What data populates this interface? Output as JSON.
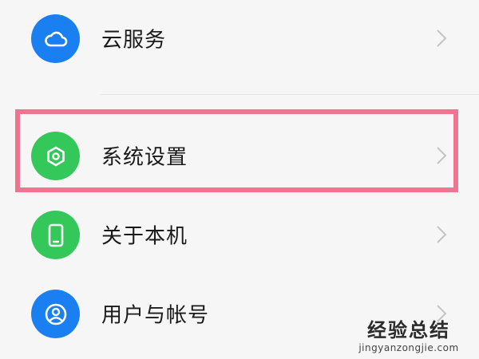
{
  "settings_items": [
    {
      "label": "云服务",
      "icon": "cloud-icon",
      "icon_color": "#1a7ff0"
    },
    {
      "label": "系统设置",
      "icon": "gear-icon",
      "icon_color": "#34c759"
    },
    {
      "label": "关于本机",
      "icon": "phone-icon",
      "icon_color": "#34c759"
    },
    {
      "label": "用户与帐号",
      "icon": "user-icon",
      "icon_color": "#1a7ff0"
    }
  ],
  "highlight_color": "#f0748f",
  "watermark": {
    "title": "经验总结",
    "url": "jingyanzongjie.com"
  }
}
